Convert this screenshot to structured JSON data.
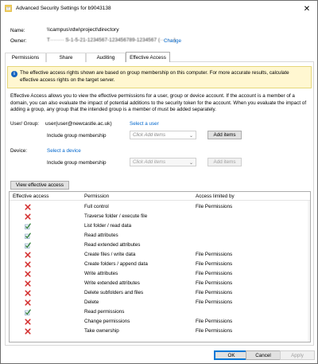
{
  "window": {
    "title": "Advanced Security Settings for b9043138"
  },
  "header": {
    "name_label": "Name:",
    "name_value": "\\\\campus\\rdw\\project\\directory",
    "owner_label": "Owner:",
    "owner_value": "T········ S-1-5-21-1234567-123456789-1234567 (········)",
    "change_link": "Change"
  },
  "tabs": [
    "Permissions",
    "Share",
    "Auditing",
    "Effective Access"
  ],
  "active_tab": "Effective Access",
  "info": {
    "text": "The effective access rights shown are based on group membership on this computer. For more accurate results, calculate effective access rights on the target server."
  },
  "description": "Effective Access allows you to view the effective permissions for a user, group or device account. If the account is a member of a domain, you can also evaluate the impact of potential additions to the security token for the account. When you evaluate the impact of adding a group, any group that the intended group is a member of must be added separately.",
  "user_section": {
    "label": "User/ Group:",
    "value": "user(user@newcastle.ac.uk)",
    "select_link": "Select a user",
    "group_label": "Include group membership",
    "dropdown_placeholder": "Click Add items",
    "add_button": "Add items"
  },
  "device_section": {
    "label": "Device:",
    "select_link": "Select a device",
    "group_label": "Include group membership",
    "dropdown_placeholder": "Click Add items",
    "add_button": "Add items"
  },
  "view_button": "View effective access",
  "table": {
    "columns": [
      "Effective access",
      "Permission",
      "Access limited by"
    ],
    "rows": [
      {
        "allowed": false,
        "permission": "Full control",
        "limited_by": "File Permissions"
      },
      {
        "allowed": false,
        "permission": "Traverse folder / execute file",
        "limited_by": ""
      },
      {
        "allowed": true,
        "permission": "List folder / read data",
        "limited_by": ""
      },
      {
        "allowed": true,
        "permission": "Read attributes",
        "limited_by": ""
      },
      {
        "allowed": true,
        "permission": "Read extended attributes",
        "limited_by": ""
      },
      {
        "allowed": false,
        "permission": "Create files / write data",
        "limited_by": "File Permissions"
      },
      {
        "allowed": false,
        "permission": "Create folders / append data",
        "limited_by": "File Permissions"
      },
      {
        "allowed": false,
        "permission": "Write attributes",
        "limited_by": "File Permissions"
      },
      {
        "allowed": false,
        "permission": "Write extended attributes",
        "limited_by": "File Permissions"
      },
      {
        "allowed": false,
        "permission": "Delete subfolders and files",
        "limited_by": "File Permissions"
      },
      {
        "allowed": false,
        "permission": "Delete",
        "limited_by": "File Permissions"
      },
      {
        "allowed": true,
        "permission": "Read permissions",
        "limited_by": ""
      },
      {
        "allowed": false,
        "permission": "Change permissions",
        "limited_by": "File Permissions"
      },
      {
        "allowed": false,
        "permission": "Take ownership",
        "limited_by": "File Permissions"
      }
    ]
  },
  "footer": {
    "ok": "OK",
    "cancel": "Cancel",
    "apply": "Apply"
  },
  "colors": {
    "deny": "#d32f2f",
    "allow": "#2e7d32",
    "link": "#0066cc",
    "info_bg": "#fff7d1"
  }
}
